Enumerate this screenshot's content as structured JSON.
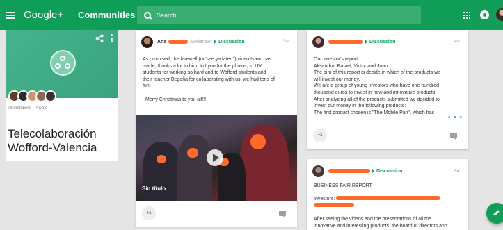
{
  "header": {
    "brand": "Google+",
    "section": "Communities",
    "search_placeholder": "Search"
  },
  "community": {
    "member_info": "79 members · Private",
    "name": "Telecolaboración Wofford-Valencia"
  },
  "posts": [
    {
      "author": "Ana",
      "role": "Moderator",
      "category": "Discussion",
      "time": "3w",
      "body": [
        "As promised, the farewell (or\"see ya later!\") video Isaac has",
        "made, thanks a lot to him, to Lynn for the photos, to UV",
        "students for working so hard and to Wofford students and",
        "their teacher Begoña for collaborating with us, we had tons of",
        "fun!",
        "",
        "Merry Christmas to you all!!!"
      ],
      "video_caption": "Sin título",
      "plus_one": "+1"
    },
    {
      "category": "Discussion",
      "time": "4w",
      "body": [
        "Our investor's report:",
        "Alejandro, Rafael, Victor and Juan.",
        "The aim of this report is decide in which of the products we",
        "will invest our money.",
        "We are a group of young investors who have one hundred",
        "thousand euros to invest in new and innovative products.",
        "After analyzing all of the products submitted we decided to",
        "invest our money in the following products:",
        "The first product chosen is \"The Mobile Pan\", which has"
      ],
      "more": "• • •",
      "plus_one": "+1"
    },
    {
      "category": "Discussion",
      "time": "4w",
      "body": [
        "BUSINESS FAIR REPORT",
        "",
        "Investors:",
        "",
        "",
        "After seeing the videos and the presentations of all the",
        "innovative and interesting products, the board of directors and"
      ]
    }
  ],
  "colors": {
    "brand_green": "#0f9d58",
    "redaction": "#ff6a2a"
  }
}
